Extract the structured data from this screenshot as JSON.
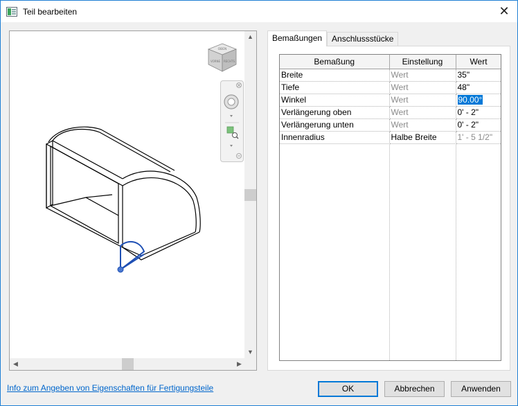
{
  "window": {
    "title": "Teil bearbeiten",
    "close_glyph": "✕"
  },
  "tabs": [
    {
      "label": "Bemaßungen",
      "active": true
    },
    {
      "label": "Anschlussstücke",
      "active": false
    }
  ],
  "grid": {
    "headers": [
      "Bemaßung",
      "Einstellung",
      "Wert"
    ],
    "rows": [
      {
        "name": "Breite",
        "setting": "Wert",
        "value": "35\""
      },
      {
        "name": "Tiefe",
        "setting": "Wert",
        "value": "48\""
      },
      {
        "name": "Winkel",
        "setting": "Wert",
        "value": "90.00°"
      },
      {
        "name": "Verlängerung oben",
        "setting": "Wert",
        "value": "0' - 2\""
      },
      {
        "name": "Verlängerung unten",
        "setting": "Wert",
        "value": "0' - 2\""
      },
      {
        "name": "Innenradius",
        "setting": "Halbe Breite",
        "value": "1' - 5 1/2\""
      }
    ]
  },
  "viewcube": {
    "faces": [
      "OBEN",
      "VORNE",
      "RECHTS"
    ]
  },
  "footer": {
    "info_link": "Info zum Angeben von Eigenschaften für Fertigungsteile",
    "ok_label": "OK",
    "cancel_label": "Abbrechen",
    "apply_label": "Anwenden"
  },
  "colors": {
    "accent": "#0078d7",
    "selection_blue": "#1e4fb4",
    "link": "#0066cc"
  }
}
